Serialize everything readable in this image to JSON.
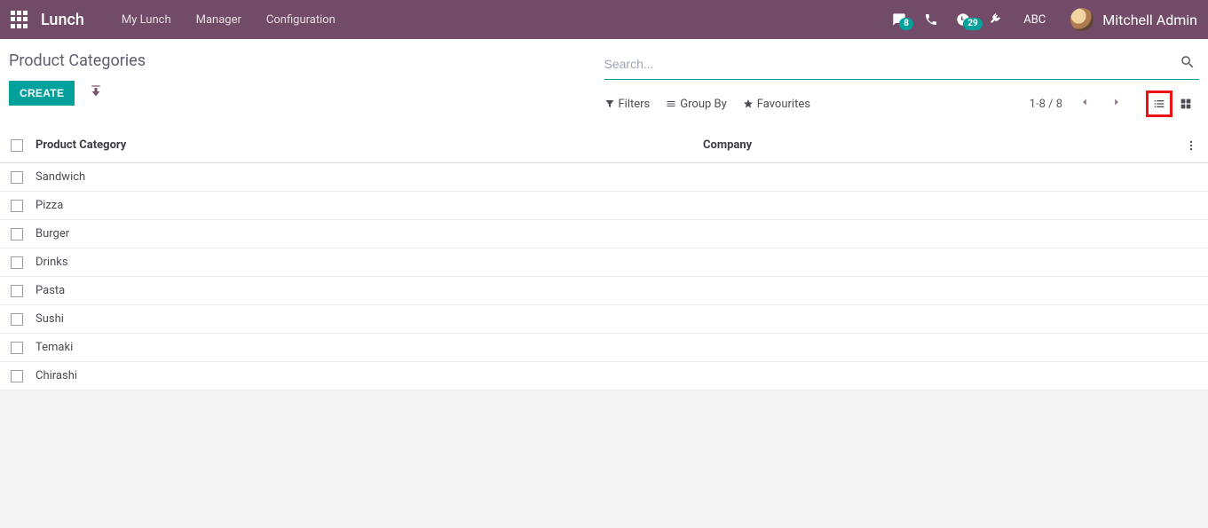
{
  "navbar": {
    "brand": "Lunch",
    "menu": [
      "My Lunch",
      "Manager",
      "Configuration"
    ],
    "messages_count": "8",
    "activities_count": "29",
    "company_short": "ABC",
    "user_name": "Mitchell Admin"
  },
  "page": {
    "title": "Product Categories",
    "create_label": "CREATE"
  },
  "search": {
    "placeholder": "Search..."
  },
  "toolbar": {
    "filters_label": "Filters",
    "groupby_label": "Group By",
    "favourites_label": "Favourites",
    "pager_text": "1-8 / 8"
  },
  "table": {
    "columns": {
      "category": "Product Category",
      "company": "Company"
    },
    "rows": [
      {
        "category": "Sandwich",
        "company": ""
      },
      {
        "category": "Pizza",
        "company": ""
      },
      {
        "category": "Burger",
        "company": ""
      },
      {
        "category": "Drinks",
        "company": ""
      },
      {
        "category": "Pasta",
        "company": ""
      },
      {
        "category": "Sushi",
        "company": ""
      },
      {
        "category": "Temaki",
        "company": ""
      },
      {
        "category": "Chirashi",
        "company": ""
      }
    ]
  }
}
